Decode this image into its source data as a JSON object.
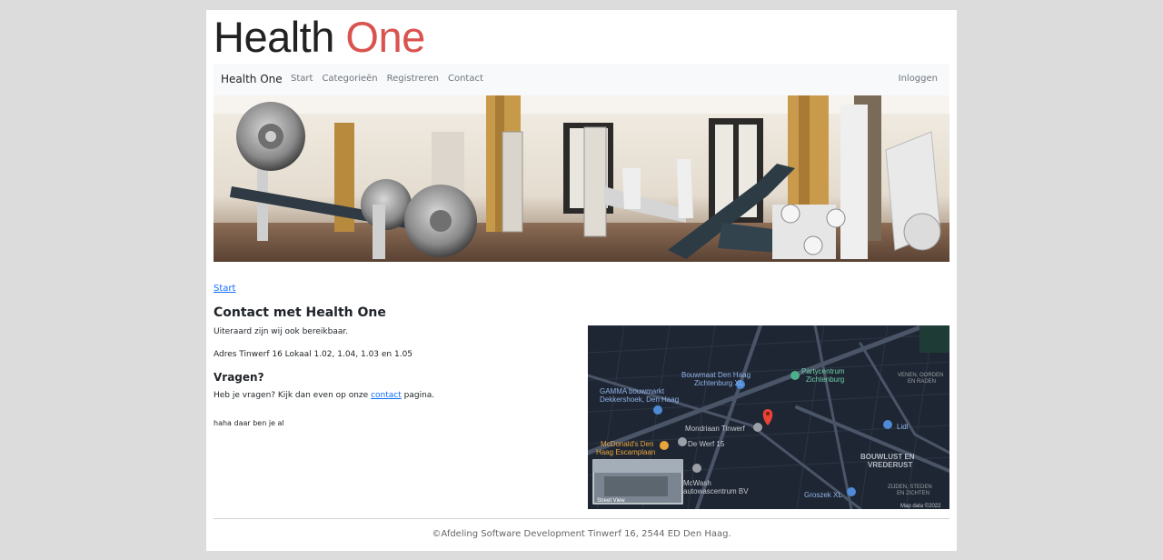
{
  "logo": {
    "part1": "Health",
    "part2": "One"
  },
  "navbar": {
    "brand": "Health One",
    "items": [
      {
        "label": "Start"
      },
      {
        "label": "Categorieën"
      },
      {
        "label": "Registreren"
      },
      {
        "label": "Contact"
      }
    ],
    "login": "Inloggen"
  },
  "breadcrumb": "Start",
  "content": {
    "heading": "Contact met Health One",
    "intro": "Uiteraard zijn wij ook bereikbaar.",
    "address": "Adres Tinwerf 16 Lokaal 1.02, 1.04, 1.03 en 1.05",
    "questions_heading": "Vragen?",
    "questions_before": "Heb je vragen? Kijk dan even op onze",
    "questions_link": "contact",
    "questions_after": "pagina.",
    "note": "haha daar ben je al"
  },
  "map": {
    "labels": {
      "bouwmaat": "Bouwmaat Den Haag",
      "bouwmaat2": "Zichtenburg XL",
      "gamma": "GAMMA bouwmarkt",
      "gamma2": "Dekkershoek, Den Haag",
      "party": "Partycentrum",
      "party2": "Zichtenburg",
      "mondriaan": "Mondriaan Tinwerf",
      "mcdonalds": "McDonald's Den",
      "mcdonalds2": "Haag Escamplaan",
      "dewerf": "De Werf 15",
      "mcwash": "McWash",
      "mcwash2": "autowascentrum BV",
      "lidl": "Lidl",
      "groszek": "Groszek XL",
      "bouwlust": "BOUWLUST EN",
      "bouwlust2": "VREDERUST",
      "venen": "VENEN, OORDEN",
      "venen2": "EN RADEN",
      "zijden": "ZIJDEN, STEDEN",
      "zijden2": "EN ZICHTEN",
      "streetview": "Street View",
      "attribution": "Map data ©2022"
    },
    "colors": {
      "bg": "#1f2633",
      "road": "#3a4556",
      "pin": "#ea4335",
      "poi_blue": "#4e8ad6",
      "poi_gray": "#9aa0a6",
      "poi_green": "#4caf8a",
      "poi_orange": "#e8a33a"
    }
  },
  "footer": "©Afdeling Software Development Tinwerf 16, 2544 ED Den Haag."
}
